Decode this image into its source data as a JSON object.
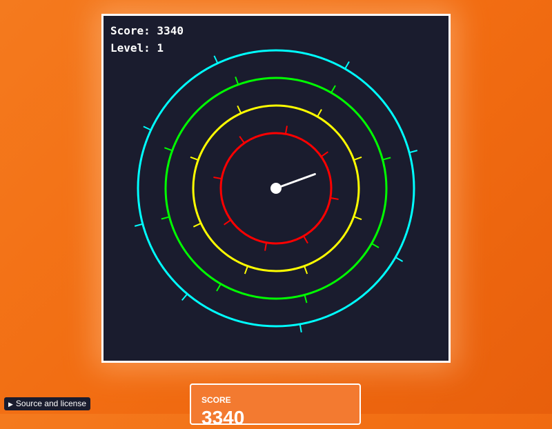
{
  "hud": {
    "score_text": "Score: 3340",
    "level_text": "Level: 1"
  },
  "score_panel": {
    "label": "SCORE",
    "value": "3340"
  },
  "footer": {
    "source_label": "Source and license",
    "source_icon": "triangle-right-icon"
  },
  "game": {
    "background": "#1a1c2e",
    "needle_angle_deg": -20,
    "rings": [
      {
        "name": "red",
        "color": "#ff0000",
        "ticks": [
          -80,
          -35,
          10,
          60,
          100,
          145,
          190,
          235
        ]
      },
      {
        "name": "yellow",
        "color": "#ffff00",
        "ticks": [
          -60,
          -20,
          20,
          70,
          110,
          155,
          200,
          245
        ]
      },
      {
        "name": "green",
        "color": "#00ff00",
        "ticks": [
          -60,
          -15,
          30,
          75,
          120,
          165,
          200,
          250
        ]
      },
      {
        "name": "cyan",
        "color": "#00ffff",
        "ticks": [
          -60,
          -15,
          30,
          80,
          130,
          165,
          205,
          245
        ]
      }
    ]
  }
}
